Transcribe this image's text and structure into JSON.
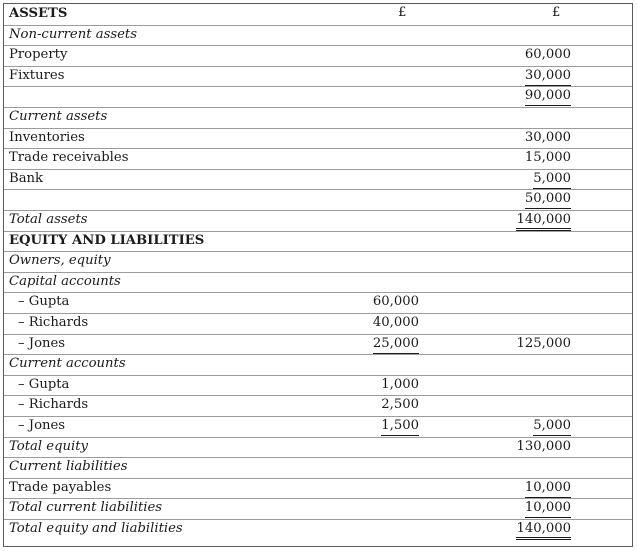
{
  "header": {
    "title": "ASSETS",
    "col1": "£",
    "col2": "£"
  },
  "rows": [
    {
      "label": "Non-current assets",
      "style": "ital"
    },
    {
      "label": "Property",
      "col2": "60,000"
    },
    {
      "label": "Fixtures",
      "col2": "30,000",
      "col2_line": "u"
    },
    {
      "label": "",
      "col2": "90,000",
      "col2_line": "u"
    },
    {
      "label": "Current assets",
      "style": "ital"
    },
    {
      "label": "Inventories",
      "col2": "30,000"
    },
    {
      "label": "Trade receivables",
      "col2": "15,000"
    },
    {
      "label": "Bank",
      "col2": "5,000",
      "col2_line": "u"
    },
    {
      "label": "",
      "col2": "50,000",
      "col2_line": "u"
    },
    {
      "label": "Total assets",
      "style": "ital",
      "col2": "140,000",
      "col2_line": "uu"
    },
    {
      "label": "EQUITY AND LIABILITIES",
      "style": "bold"
    },
    {
      "label": "Owners, equity",
      "style": "ital"
    },
    {
      "label": "Capital accounts",
      "style": "ital"
    },
    {
      "label": "– Gupta",
      "indent": true,
      "col1": "60,000"
    },
    {
      "label": "– Richards",
      "indent": true,
      "col1": "40,000"
    },
    {
      "label": "– Jones",
      "indent": true,
      "col1": "25,000",
      "col1_line": "u",
      "col2": "125,000"
    },
    {
      "label": "Current accounts",
      "style": "ital"
    },
    {
      "label": "– Gupta",
      "indent": true,
      "col1": "1,000"
    },
    {
      "label": "– Richards",
      "indent": true,
      "col1": "2,500"
    },
    {
      "label": "– Jones",
      "indent": true,
      "col1": "1,500",
      "col1_line": "u",
      "col2": "5,000",
      "col2_line": "u"
    },
    {
      "label": "Total equity",
      "style": "ital",
      "col2": "130,000"
    },
    {
      "label": "Current liabilities",
      "style": "ital"
    },
    {
      "label": "Trade payables",
      "col2": "10,000",
      "col2_line": "u"
    },
    {
      "label": "Total current liabilities",
      "style": "ital",
      "col2": "10,000",
      "col2_line": "u"
    },
    {
      "label": "Total equity and liabilities",
      "style": "ital",
      "col2": "140,000",
      "col2_line": "uu"
    }
  ]
}
